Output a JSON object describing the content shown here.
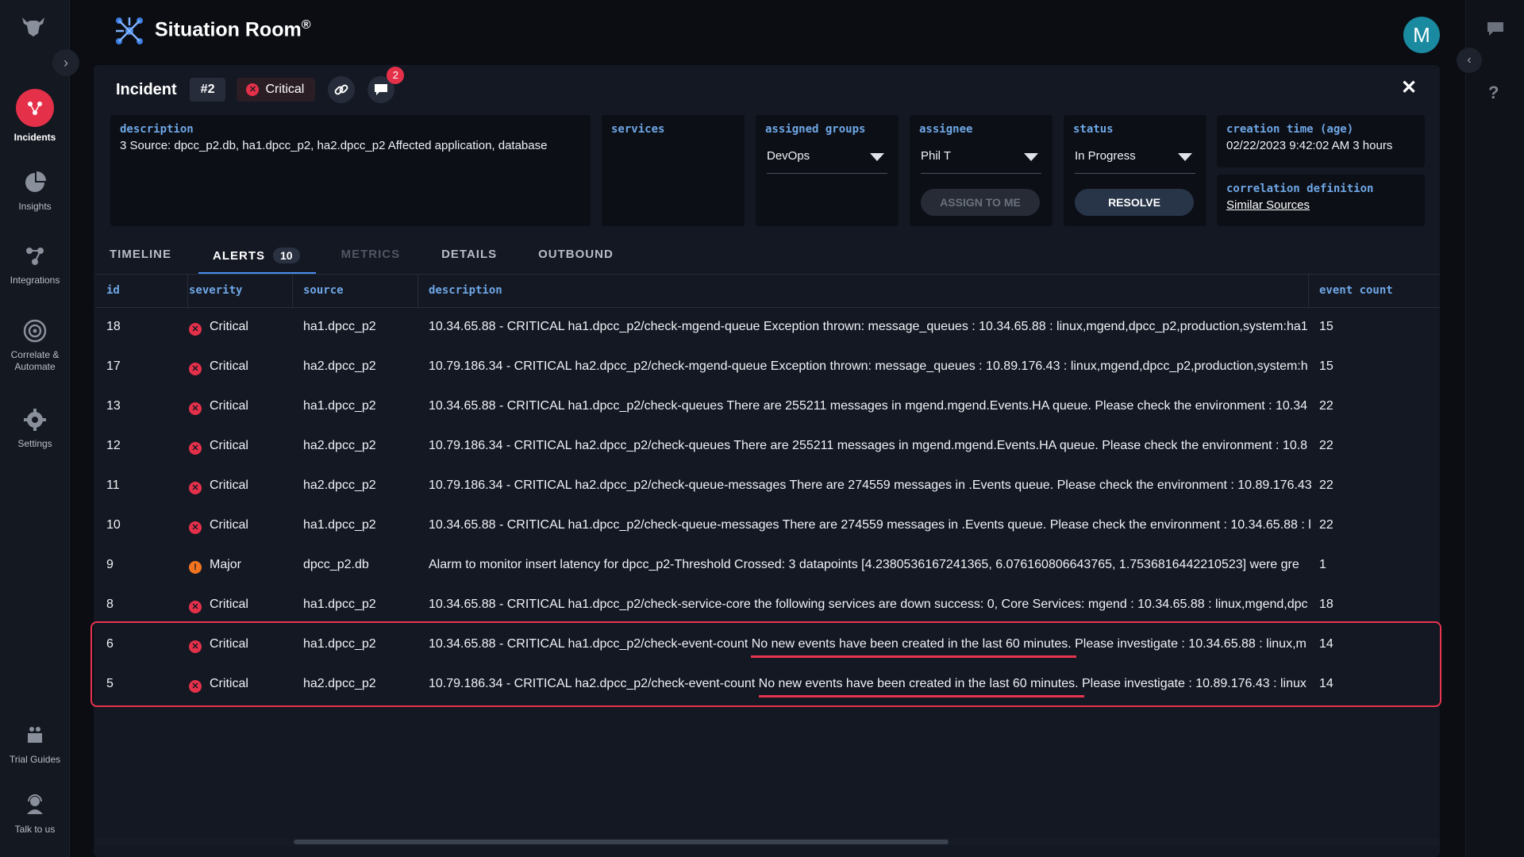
{
  "app": {
    "title": "Situation Room",
    "registered_mark": "®",
    "avatar_initial": "M"
  },
  "leftnav": {
    "items": [
      {
        "label": "Incidents",
        "icon": "incidents-icon",
        "active": true
      },
      {
        "label": "Insights",
        "icon": "pie-chart-icon"
      },
      {
        "label": "Integrations",
        "icon": "integrations-icon"
      },
      {
        "label_line1": "Correlate &",
        "label_line2": "Automate",
        "icon": "target-icon"
      },
      {
        "label": "Settings",
        "icon": "gear-icon"
      }
    ],
    "bottom": [
      {
        "label": "Trial Guides",
        "icon": "guides-icon"
      },
      {
        "label": "Talk to us",
        "icon": "support-icon"
      }
    ]
  },
  "incident": {
    "label": "Incident",
    "id": "#2",
    "severity": "Critical",
    "comments_count": "2"
  },
  "cards": {
    "description": {
      "label": "description",
      "value": "3 Source: dpcc_p2.db, ha1.dpcc_p2, ha2.dpcc_p2 Affected application, database"
    },
    "services": {
      "label": "services"
    },
    "assigned_groups": {
      "label": "assigned groups",
      "value": "DevOps"
    },
    "assignee": {
      "label": "assignee",
      "value": "Phil T",
      "button": "ASSIGN TO ME"
    },
    "status": {
      "label": "status",
      "value": "In Progress",
      "button": "RESOLVE"
    },
    "creation_time": {
      "label": "creation time (age)",
      "value": "02/22/2023 9:42:02 AM 3 hours"
    },
    "correlation": {
      "label": "correlation definition",
      "value": "Similar Sources"
    }
  },
  "tabs": [
    {
      "label": "TIMELINE"
    },
    {
      "label": "ALERTS",
      "count": "10",
      "active": true
    },
    {
      "label": "METRICS",
      "disabled": true
    },
    {
      "label": "DETAILS"
    },
    {
      "label": "OUTBOUND"
    }
  ],
  "table": {
    "columns": [
      "id",
      "severity",
      "source",
      "description",
      "event count"
    ],
    "rows": [
      {
        "id": "18",
        "severity": "Critical",
        "source": "ha1.dpcc_p2",
        "description": "10.34.65.88 - CRITICAL ha1.dpcc_p2/check-mgend-queue Exception thrown: message_queues : 10.34.65.88 : linux,mgend,dpcc_p2,production,system:ha1",
        "count": "15"
      },
      {
        "id": "17",
        "severity": "Critical",
        "source": "ha2.dpcc_p2",
        "description": "10.79.186.34 - CRITICAL ha2.dpcc_p2/check-mgend-queue Exception thrown: message_queues : 10.89.176.43 : linux,mgend,dpcc_p2,production,system:h",
        "count": "15"
      },
      {
        "id": "13",
        "severity": "Critical",
        "source": "ha1.dpcc_p2",
        "description": "10.34.65.88 - CRITICAL ha1.dpcc_p2/check-queues There are 255211 messages in mgend.mgend.Events.HA queue. Please check the environment : 10.34",
        "count": "22"
      },
      {
        "id": "12",
        "severity": "Critical",
        "source": "ha2.dpcc_p2",
        "description": "10.79.186.34 - CRITICAL ha2.dpcc_p2/check-queues There are 255211 messages in mgend.mgend.Events.HA queue. Please check the environment : 10.8",
        "count": "22"
      },
      {
        "id": "11",
        "severity": "Critical",
        "source": "ha2.dpcc_p2",
        "description": "10.79.186.34 - CRITICAL ha2.dpcc_p2/check-queue-messages There are 274559 messages in .Events queue. Please check the environment : 10.89.176.43",
        "count": "22"
      },
      {
        "id": "10",
        "severity": "Critical",
        "source": "ha1.dpcc_p2",
        "description": "10.34.65.88 - CRITICAL ha1.dpcc_p2/check-queue-messages There are 274559 messages in .Events queue. Please check the environment : 10.34.65.88 : l",
        "count": "22"
      },
      {
        "id": "9",
        "severity": "Major",
        "source": "dpcc_p2.db",
        "description": "Alarm to monitor insert latency for dpcc_p2-Threshold Crossed: 3 datapoints [4.2380536167241365, 6.076160806643765, 1.7536816442210523] were gre",
        "count": "1"
      },
      {
        "id": "8",
        "severity": "Critical",
        "source": "ha1.dpcc_p2",
        "description": "10.34.65.88 - CRITICAL ha1.dpcc_p2/check-service-core the following services are down success: 0, Core Services: mgend : 10.34.65.88 : linux,mgend,dpc",
        "count": "18"
      },
      {
        "id": "6",
        "severity": "Critical",
        "source": "ha1.dpcc_p2",
        "description": "10.34.65.88 - CRITICAL ha1.dpcc_p2/check-event-count No new events have been created in the last 60 minutes. Please investigate : 10.34.65.88 : linux,m",
        "count": "14"
      },
      {
        "id": "5",
        "severity": "Critical",
        "source": "ha2.dpcc_p2",
        "description": "10.79.186.34 - CRITICAL ha2.dpcc_p2/check-event-count No new events have been created in the last 60 minutes. Please investigate : 10.89.176.43 : linux",
        "count": "14"
      }
    ]
  },
  "colors": {
    "critical": "#e5304a",
    "major": "#f2741f",
    "accent": "#4b8ef0",
    "label": "#6fa7e6",
    "highlight": "#e8344f"
  }
}
